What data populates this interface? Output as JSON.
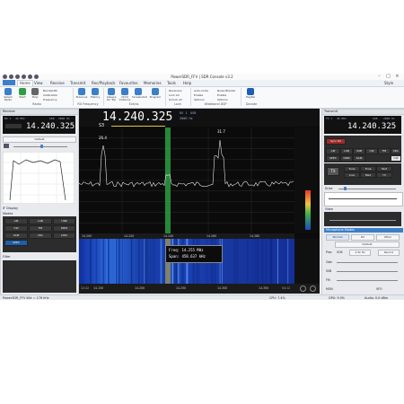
{
  "window": {
    "title": "PowerSDR_FFV | SDR Console v3.2",
    "tabs": [
      "Home",
      "View",
      "Receive",
      "Transmit",
      "Rec/Playback",
      "Favourites",
      "Memories",
      "Tools",
      "Help"
    ],
    "active_tab": "Home",
    "style_label": "Style"
  },
  "ribbon": {
    "buttons": [
      {
        "label": "Select Radio"
      },
      {
        "label": "Start"
      },
      {
        "label": "Stop"
      },
      {
        "label": "Previous"
      },
      {
        "label": "History"
      },
      {
        "label": "Always On Top"
      },
      {
        "label": "Child Instance"
      },
      {
        "label": "Screenshot"
      },
      {
        "label": "Program"
      },
      {
        "label": "PayPal"
      }
    ],
    "small_items": {
      "bandwidth": "Bandwidth",
      "calibration": "Calibration",
      "frequency": "Frequency",
      "receivers": "Receivers",
      "lock_all": "Lock All",
      "unlock_all": "Unlock all",
      "auto_mute": "Auto-mute",
      "noise_blanker": "Noise Blanker",
      "enable_1": "Enable",
      "enable_2": "Enable",
      "options_1": "Options",
      "options_2": "Options"
    },
    "groups": [
      "Radio",
      "RX Frequency",
      "Extras",
      "Lock",
      "Wideband DSP",
      "Donate"
    ]
  },
  "left_panel": {
    "title": "Receive",
    "rx_label": "RX 1",
    "rx_band": "40 MHz",
    "mode": "USB",
    "bandwidth": "2800 Hz",
    "frequency": "14.240.325",
    "default_label": "Default",
    "display_label": "IF Display",
    "modes_label": "Modes",
    "mode_buttons": [
      "AM",
      "LSB",
      "USB",
      "CW",
      "FM",
      "DRM",
      "SAM",
      "DIG",
      "CWU",
      "SPEC"
    ],
    "filter_label": "Filter"
  },
  "spectrum": {
    "frequency": "14.240.325",
    "rx_label": "RX 1",
    "mode": "USB",
    "bandwidth": "2800 Hz",
    "smeter": "S3",
    "peak_labels": [
      "26.4",
      "31.7"
    ],
    "db_scale": [
      "-40",
      "-50",
      "-60",
      "-70",
      "-80",
      "-90",
      "-100",
      "-110",
      "-120",
      "-130"
    ],
    "freq_scale": [
      "14.200",
      "14.220",
      "14.240",
      "14.260",
      "14.280"
    ],
    "wf_scale": [
      "14.150",
      "14.200",
      "14.250",
      "14.300",
      "14.350"
    ],
    "tooltip_freq": "Freq: 14.255 MHz",
    "tooltip_span": "Span: 458.637 kHz",
    "wf_left_time": "12:42",
    "wf_right_time": "04:12"
  },
  "right_panel": {
    "title": "Transmit",
    "tx_label": "TX 1",
    "tx_band": "40 MHz",
    "mode": "USB",
    "bandwidth": "2800 Hz",
    "frequency": "14.240.325",
    "sync_rx": "Sync RX",
    "mode_buttons": [
      "AM",
      "LSB",
      "USB",
      "CW",
      "FM",
      "DIG",
      "SPEC",
      "DRM",
      "SAM",
      "CW"
    ],
    "tx_button": "TX",
    "tx_opts": [
      "Tune",
      "Tone",
      "Test"
    ],
    "sub_buttons": [
      "Low",
      "Med",
      "Hi"
    ],
    "drive_label": "Drive",
    "video_label": "Video",
    "mic_title": "Microphone Modes",
    "mic_modes": [
      "Normal",
      "DX",
      "Other"
    ],
    "default_label": "Default",
    "proc_label": "Proc",
    "voice_label": "VOX",
    "cfc_value": "2.5k Hz",
    "record_label": "Record",
    "gain_label": "Gain",
    "ssb_label": "SSB",
    "fm_label": "FM",
    "monitor_label": "MON",
    "vfo_label": "VFO"
  },
  "status": {
    "left": "PowerSDR_FFV 64k = 176 kHz",
    "cpu": "CPU: 7.4%",
    "gpu": "GPU: 9.0%",
    "audio": "Audio: 0.0 dBm"
  }
}
